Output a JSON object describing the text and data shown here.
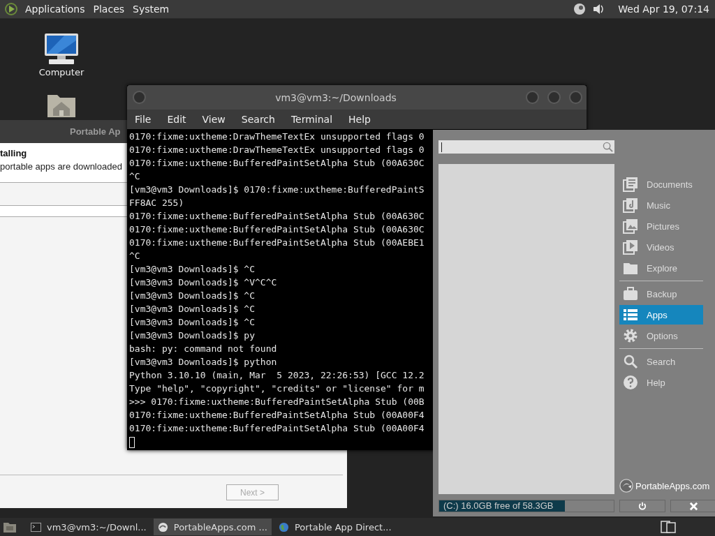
{
  "top_panel": {
    "menus": [
      "Applications",
      "Places",
      "System"
    ],
    "clock": "Wed Apr 19, 07:14"
  },
  "desktop_icons": [
    {
      "label": "Computer"
    }
  ],
  "installer_dialog": {
    "title": "Portable Ap",
    "heading": "talling",
    "description": "portable apps are downloaded",
    "next_button": {
      "label": "Next >",
      "disabled": true
    }
  },
  "terminal": {
    "title": "vm3@vm3:~/Downloads",
    "menus": [
      "File",
      "Edit",
      "View",
      "Search",
      "Terminal",
      "Help"
    ],
    "lines": [
      "0170:fixme:uxtheme:DrawThemeTextEx unsupported flags 0",
      "0170:fixme:uxtheme:DrawThemeTextEx unsupported flags 0",
      "0170:fixme:uxtheme:BufferedPaintSetAlpha Stub (00A630C",
      "^C",
      "[vm3@vm3 Downloads]$ 0170:fixme:uxtheme:BufferedPaintS",
      "FF8AC 255)",
      "0170:fixme:uxtheme:BufferedPaintSetAlpha Stub (00A630C",
      "0170:fixme:uxtheme:BufferedPaintSetAlpha Stub (00A630C",
      "0170:fixme:uxtheme:BufferedPaintSetAlpha Stub (00AEBE1",
      "^C",
      "[vm3@vm3 Downloads]$ ^C",
      "[vm3@vm3 Downloads]$ ^V^C^C",
      "[vm3@vm3 Downloads]$ ^C",
      "[vm3@vm3 Downloads]$ ^C",
      "[vm3@vm3 Downloads]$ ^C",
      "[vm3@vm3 Downloads]$ py",
      "bash: py: command not found",
      "[vm3@vm3 Downloads]$ python",
      "Python 3.10.10 (main, Mar  5 2023, 22:26:53) [GCC 12.2",
      "Type \"help\", \"copyright\", \"credits\" or \"license\" for m",
      ">>> 0170:fixme:uxtheme:BufferedPaintSetAlpha Stub (00B",
      "0170:fixme:uxtheme:BufferedPaintSetAlpha Stub (00A00F4",
      "0170:fixme:uxtheme:BufferedPaintSetAlpha Stub (00A00F4"
    ]
  },
  "portableapps_menu": {
    "nav_groups": [
      {
        "items": [
          {
            "label": "Documents",
            "selected": false
          },
          {
            "label": "Music",
            "selected": false
          },
          {
            "label": "Pictures",
            "selected": false
          },
          {
            "label": "Videos",
            "selected": false
          },
          {
            "label": "Explore",
            "selected": false
          }
        ]
      },
      {
        "items": [
          {
            "label": "Backup",
            "selected": false
          },
          {
            "label": "Apps",
            "selected": true
          },
          {
            "label": "Options",
            "selected": false
          }
        ]
      },
      {
        "items": [
          {
            "label": "Search",
            "selected": false
          },
          {
            "label": "Help",
            "selected": false
          }
        ]
      }
    ],
    "brand": "PortableApps.com",
    "drive": {
      "label": "(C:) 16.0GB free of 58.3GB",
      "level": 0.72
    }
  },
  "taskbar": {
    "tasks": [
      {
        "title": "vm3@vm3:~/Downl...",
        "selected": false
      },
      {
        "title": "PortableApps.com ...",
        "selected": true
      },
      {
        "title": "Portable App Direct...",
        "selected": false
      }
    ]
  }
}
